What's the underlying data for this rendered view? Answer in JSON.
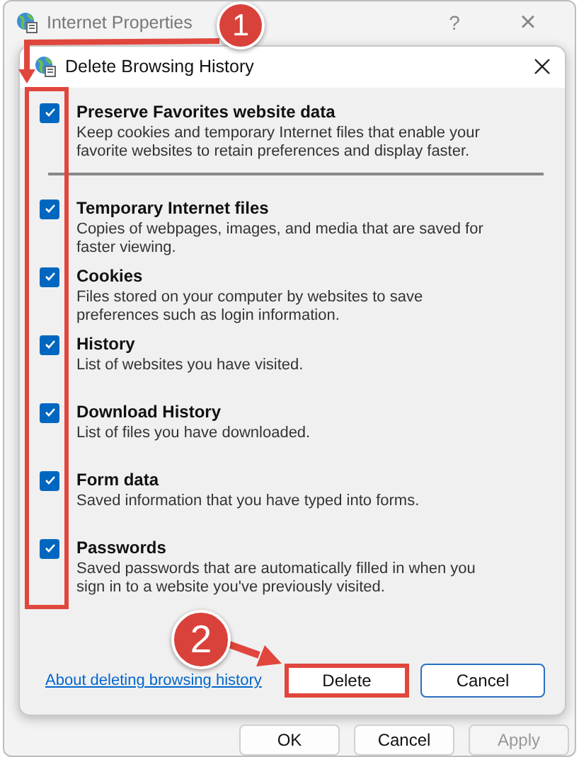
{
  "window": {
    "title": "Internet Properties",
    "buttons": [
      {
        "label": "?",
        "kind": "help"
      },
      {
        "label": "×",
        "kind": "close"
      }
    ]
  },
  "dialog": {
    "title": "Delete Browsing History",
    "options": [
      {
        "label": "Preserve Favorites website data",
        "description": "Keep cookies and temporary Internet files that enable your favorite websites to retain preferences and display faster.",
        "checked": true
      },
      {
        "label": "Temporary Internet files",
        "description": "Copies of webpages, images, and media that are saved for faster viewing.",
        "checked": true
      },
      {
        "label": "Cookies",
        "description": "Files stored on your computer by websites to save preferences such as login information.",
        "checked": true
      },
      {
        "label": "History",
        "description": "List of websites you have visited.",
        "checked": true
      },
      {
        "label": "Download History",
        "description": "List of files you have downloaded.",
        "checked": true
      },
      {
        "label": "Form data",
        "description": "Saved information that you have typed into forms.",
        "checked": true
      },
      {
        "label": "Passwords",
        "description": "Saved passwords that are automatically filled in when you sign in to a website you've previously visited.",
        "checked": true
      }
    ],
    "link": "About deleting browsing history",
    "buttons": [
      {
        "label": "Delete",
        "highlighted": true
      },
      {
        "label": "Cancel",
        "highlighted": false
      }
    ]
  },
  "footer_buttons": [
    {
      "label": "OK",
      "disabled": false
    },
    {
      "label": "Cancel",
      "disabled": false
    },
    {
      "label": "Apply",
      "disabled": true
    }
  ],
  "annotations": [
    {
      "kind": "badge",
      "label": "1"
    },
    {
      "kind": "badge",
      "label": "2"
    }
  ]
}
